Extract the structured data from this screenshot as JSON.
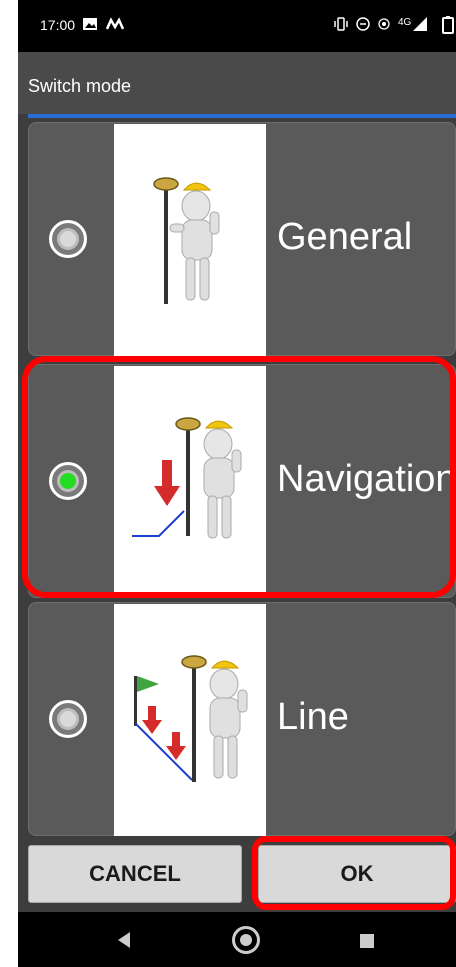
{
  "status_bar": {
    "time": "17:00",
    "left_icons": [
      "image-icon",
      "m-logo-icon"
    ],
    "right_icons": [
      "vibrate-icon",
      "dnd-icon",
      "hotspot-icon",
      "signal-4g-icon",
      "battery-icon"
    ],
    "network_label": "4G"
  },
  "dialog": {
    "title": "Switch mode",
    "options": [
      {
        "label": "General",
        "selected": false,
        "image": "surveyor-general-icon"
      },
      {
        "label": "Navigation",
        "selected": true,
        "image": "surveyor-navigation-icon"
      },
      {
        "label": "Line",
        "selected": false,
        "image": "surveyor-line-icon"
      }
    ],
    "cancel_label": "CANCEL",
    "ok_label": "OK"
  },
  "colors": {
    "selected_radio": "#22dd22",
    "highlight": "#ff0000",
    "title_divider": "#2b6bd6"
  }
}
